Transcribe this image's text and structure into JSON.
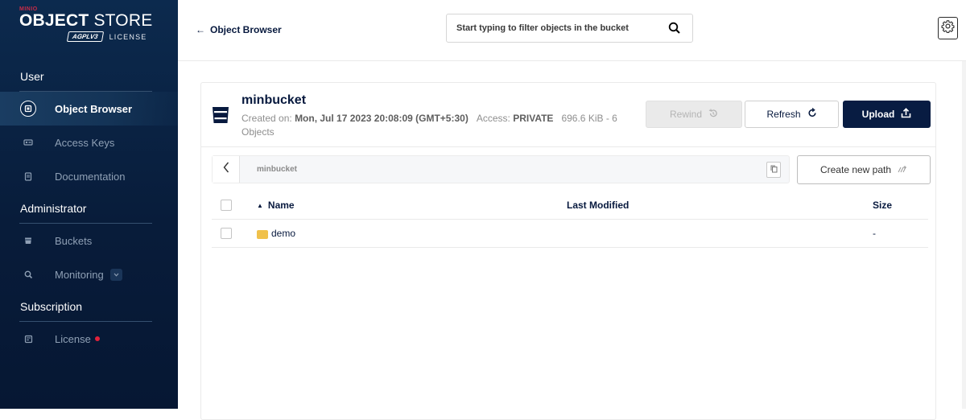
{
  "app": {
    "minio_mark": "MINIO",
    "brand_bold": "OBJECT",
    "brand_light": "STORE",
    "agpl_badge": "AGPLV3",
    "license_label": "LICENSE"
  },
  "sidebar": {
    "sections": [
      {
        "title": "User",
        "items": [
          {
            "label": "Object Browser",
            "icon": "object-browser-icon",
            "active": true
          },
          {
            "label": "Access Keys",
            "icon": "access-keys-icon"
          },
          {
            "label": "Documentation",
            "icon": "documentation-icon"
          }
        ]
      },
      {
        "title": "Administrator",
        "items": [
          {
            "label": "Buckets",
            "icon": "buckets-icon"
          },
          {
            "label": "Monitoring",
            "icon": "monitoring-icon",
            "expandable": true
          }
        ]
      },
      {
        "title": "Subscription",
        "items": [
          {
            "label": "License",
            "icon": "license-icon",
            "badge": "red-dot"
          }
        ]
      }
    ]
  },
  "topbar": {
    "back_label": "Object Browser",
    "search_placeholder": "Start typing to filter objects in the bucket"
  },
  "bucket": {
    "name": "minbucket",
    "created_prefix": "Created on:",
    "created_value": "Mon, Jul 17 2023 20:08:09 (GMT+5:30)",
    "access_prefix": "Access:",
    "access_value": "PRIVATE",
    "size_objects": "696.6 KiB - 6 Objects"
  },
  "actions": {
    "rewind_label": "Rewind",
    "refresh_label": "Refresh",
    "upload_label": "Upload",
    "create_path_label": "Create new path"
  },
  "path": {
    "current": "minbucket"
  },
  "table": {
    "columns": {
      "name": "Name",
      "modified": "Last Modified",
      "size": "Size"
    },
    "rows": [
      {
        "name": "demo",
        "type": "folder",
        "modified": "",
        "size": "-"
      }
    ]
  },
  "colors": {
    "sidebar_bg": "#0c2a4e",
    "primary": "#081c42",
    "folder": "#f0c14b",
    "alert": "#e2223b"
  }
}
